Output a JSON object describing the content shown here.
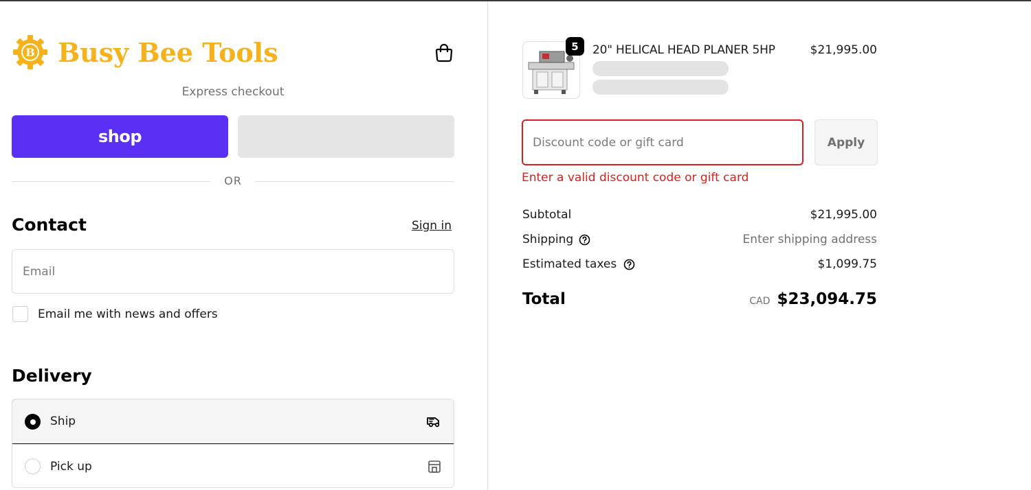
{
  "brand": {
    "name": "Busy Bee Tools",
    "logo_letter": "B",
    "color": "#f5b21c"
  },
  "express": {
    "title": "Express checkout",
    "shop_label": "shop",
    "shop_color": "#5a31f4"
  },
  "divider_text": "OR",
  "contact": {
    "heading": "Contact",
    "sign_in": "Sign in",
    "email_placeholder": "Email",
    "newsletter_label": "Email me with news and offers"
  },
  "delivery": {
    "heading": "Delivery",
    "options": [
      {
        "label": "Ship",
        "selected": true,
        "icon": "truck-icon"
      },
      {
        "label": "Pick up",
        "selected": false,
        "icon": "store-icon"
      }
    ]
  },
  "order": {
    "item": {
      "name": "20\" HELICAL HEAD PLANER 5HP",
      "price": "$21,995.00",
      "quantity": "5"
    },
    "discount_placeholder": "Discount code or gift card",
    "apply_label": "Apply",
    "error": "Enter a valid discount code or gift card",
    "error_color": "#dd1d1d",
    "summary": {
      "subtotal_label": "Subtotal",
      "subtotal_value": "$21,995.00",
      "shipping_label": "Shipping",
      "shipping_value": "Enter shipping address",
      "taxes_label": "Estimated taxes",
      "taxes_value": "$1,099.75",
      "total_label": "Total",
      "currency": "CAD",
      "total_value": "$23,094.75"
    }
  }
}
